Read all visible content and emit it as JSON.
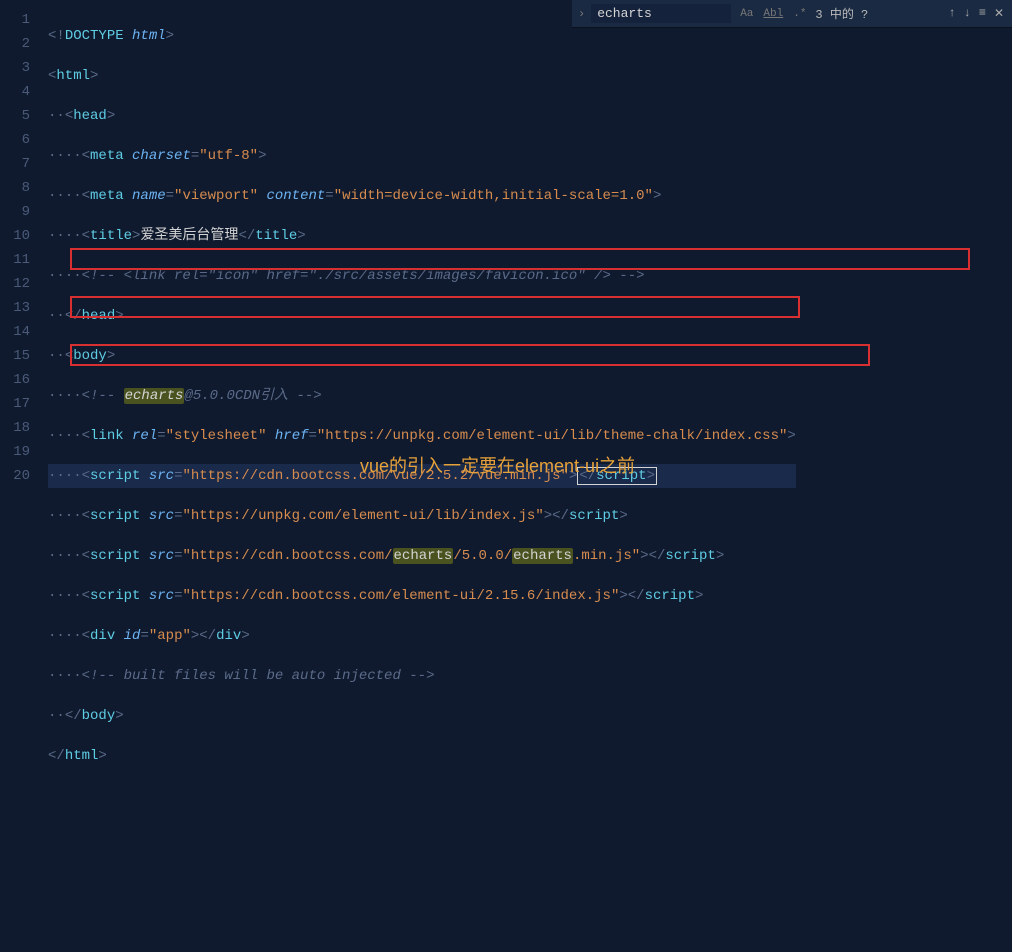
{
  "find": {
    "value": "echarts",
    "status": "3 中的 ?",
    "opt_case": "Aa",
    "opt_word": "Abl",
    "opt_regex": ".*"
  },
  "gutter": [
    "1",
    "2",
    "3",
    "4",
    "5",
    "6",
    "7",
    "8",
    "9",
    "10",
    "11",
    "12",
    "13",
    "14",
    "15",
    "16",
    "17",
    "18",
    "19",
    "20"
  ],
  "code": {
    "l1_doctype": "DOCTYPE",
    "l1_html": "html",
    "l2_open": "html",
    "l3_open": "head",
    "l4_tag": "meta",
    "l4_a1": "charset",
    "l4_v1": "\"utf-8\"",
    "l5_tag": "meta",
    "l5_a1": "name",
    "l5_v1": "\"viewport\"",
    "l5_a2": "content",
    "l5_v2": "\"width=device-width,initial-scale=1.0\"",
    "l6_open": "title",
    "l6_text": "爱圣美后台管理",
    "l6_close": "title",
    "l7_cmt": "<!-- <link rel=\"icon\" href=\"./src/assets/images/favicon.ico\" /> -->",
    "l8_close": "head",
    "l9_open": "body",
    "l10_pre": "<!-- ",
    "l10_hl": "echarts",
    "l10_rest": "@5.0.0CDN引入 -->",
    "l11_tag": "link",
    "l11_a1": "rel",
    "l11_v1": "\"stylesheet\"",
    "l11_a2": "href",
    "l11_v2": "\"https://unpkg.com/element-ui/lib/theme-chalk/index.css\"",
    "l12_tag": "script",
    "l12_a1": "src",
    "l12_v1": "\"https://cdn.bootcss.com/vue/2.5.2/vue.min.js\"",
    "l12_close": "script",
    "l13_tag": "script",
    "l13_a1": "src",
    "l13_v1": "\"https://unpkg.com/element-ui/lib/index.js\"",
    "l13_close": "script",
    "l14_tag": "script",
    "l14_a1": "src",
    "l14_v1a": "\"https://cdn.bootcss.com/",
    "l14_hl1": "echarts",
    "l14_v1b": "/5.0.0/",
    "l14_hl2": "echarts",
    "l14_v1c": ".min.js\"",
    "l14_close": "script",
    "l15_tag": "script",
    "l15_a1": "src",
    "l15_v1": "\"https://cdn.bootcss.com/element-ui/2.15.6/index.js\"",
    "l15_close": "script",
    "l16_tag": "div",
    "l16_a1": "id",
    "l16_v1": "\"app\"",
    "l16_close": "div",
    "l17_cmt": "<!-- built files will be auto injected -->",
    "l18_close": "body",
    "l19_close": "html"
  },
  "annotation": "vue的引入一定要在element-ui之前"
}
